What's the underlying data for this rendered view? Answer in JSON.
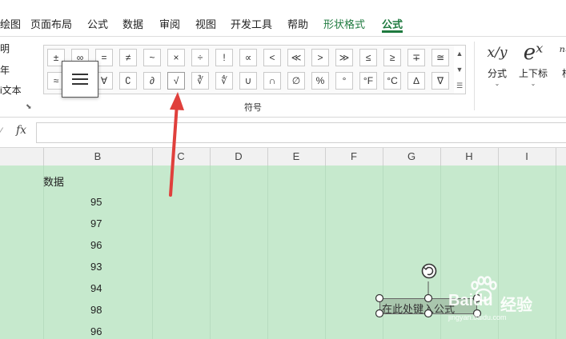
{
  "menu_tabs": [
    "绘图",
    "页面布局",
    "公式",
    "数据",
    "审阅",
    "视图",
    "开发工具",
    "帮助",
    "形状格式",
    "公式"
  ],
  "ribbon_left": [
    "明",
    "年",
    "i文本"
  ],
  "symbols": {
    "row1": [
      "±",
      "∞",
      "=",
      "≠",
      "~",
      "×",
      "÷",
      "!",
      "∝",
      "<",
      "≪",
      ">",
      "≫",
      "≤",
      "≥",
      "∓",
      "≅"
    ],
    "row2": [
      "≈",
      "≡",
      "∀",
      "∁",
      "∂",
      "√",
      "∛",
      "∜",
      "∪",
      "∩",
      "∅",
      "%",
      "°",
      "°F",
      "°C",
      "∆",
      "∇"
    ]
  },
  "symbols_group_label": "符号",
  "equation_tools": [
    {
      "icon": "x/y",
      "label": "分式"
    },
    {
      "icon": "eˣ",
      "label": "上下标"
    },
    {
      "icon": "ⁿ√",
      "label": "根"
    }
  ],
  "formula_bar": {
    "fx": "fx",
    "value": ""
  },
  "columns": [
    "B",
    "C",
    "D",
    "E",
    "F",
    "G",
    "H",
    "I"
  ],
  "sheet": {
    "header": "数据",
    "values": [
      "95",
      "97",
      "96",
      "93",
      "94",
      "98",
      "96"
    ]
  },
  "textbox_placeholder": "在此处键入公式",
  "watermark": {
    "brand": "Baidu",
    "text": "经验",
    "url": "jingyan.baidu.com"
  },
  "colors": {
    "sheet_bg": "#c6e9cd",
    "accent": "#1f7a3f",
    "arrow": "#e0403c"
  }
}
